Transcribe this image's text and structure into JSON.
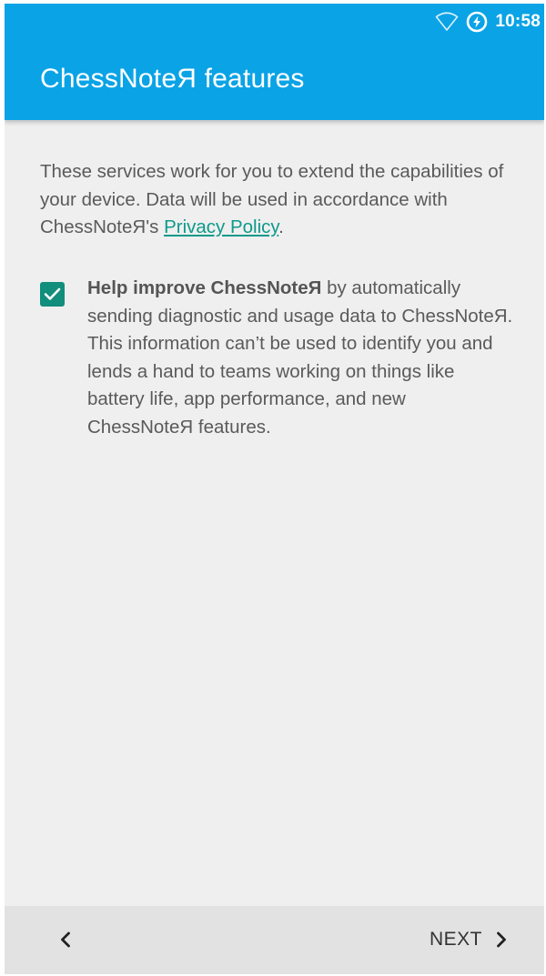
{
  "status_bar": {
    "time": "10:58",
    "icons": [
      "wifi-icon",
      "battery-saver-icon"
    ]
  },
  "header": {
    "title": "ChessNoteЯ features"
  },
  "intro": {
    "text_before_link": "These services work for you to extend the capabilities of your device. Data will be used in accordance with ChessNoteЯ's ",
    "link_label": "Privacy Policy",
    "text_after_link": "."
  },
  "consent": {
    "checked": true,
    "bold_text": "Help improve ChessNoteЯ",
    "body_text": " by automatically sending diagnostic and usage data to ChessNoteЯ. This information can’t be used to identify you and lends a hand to teams working on things like battery life, app performance, and new ChessNoteЯ features."
  },
  "footer": {
    "back_icon": "chevron-left-icon",
    "next_label": "NEXT",
    "next_icon": "chevron-right-icon"
  },
  "colors": {
    "app_bar": "#0aa3e6",
    "accent": "#118e7c",
    "link": "#0d9a8b",
    "background": "#efefef",
    "bottom_bar": "#e2e2e2"
  }
}
